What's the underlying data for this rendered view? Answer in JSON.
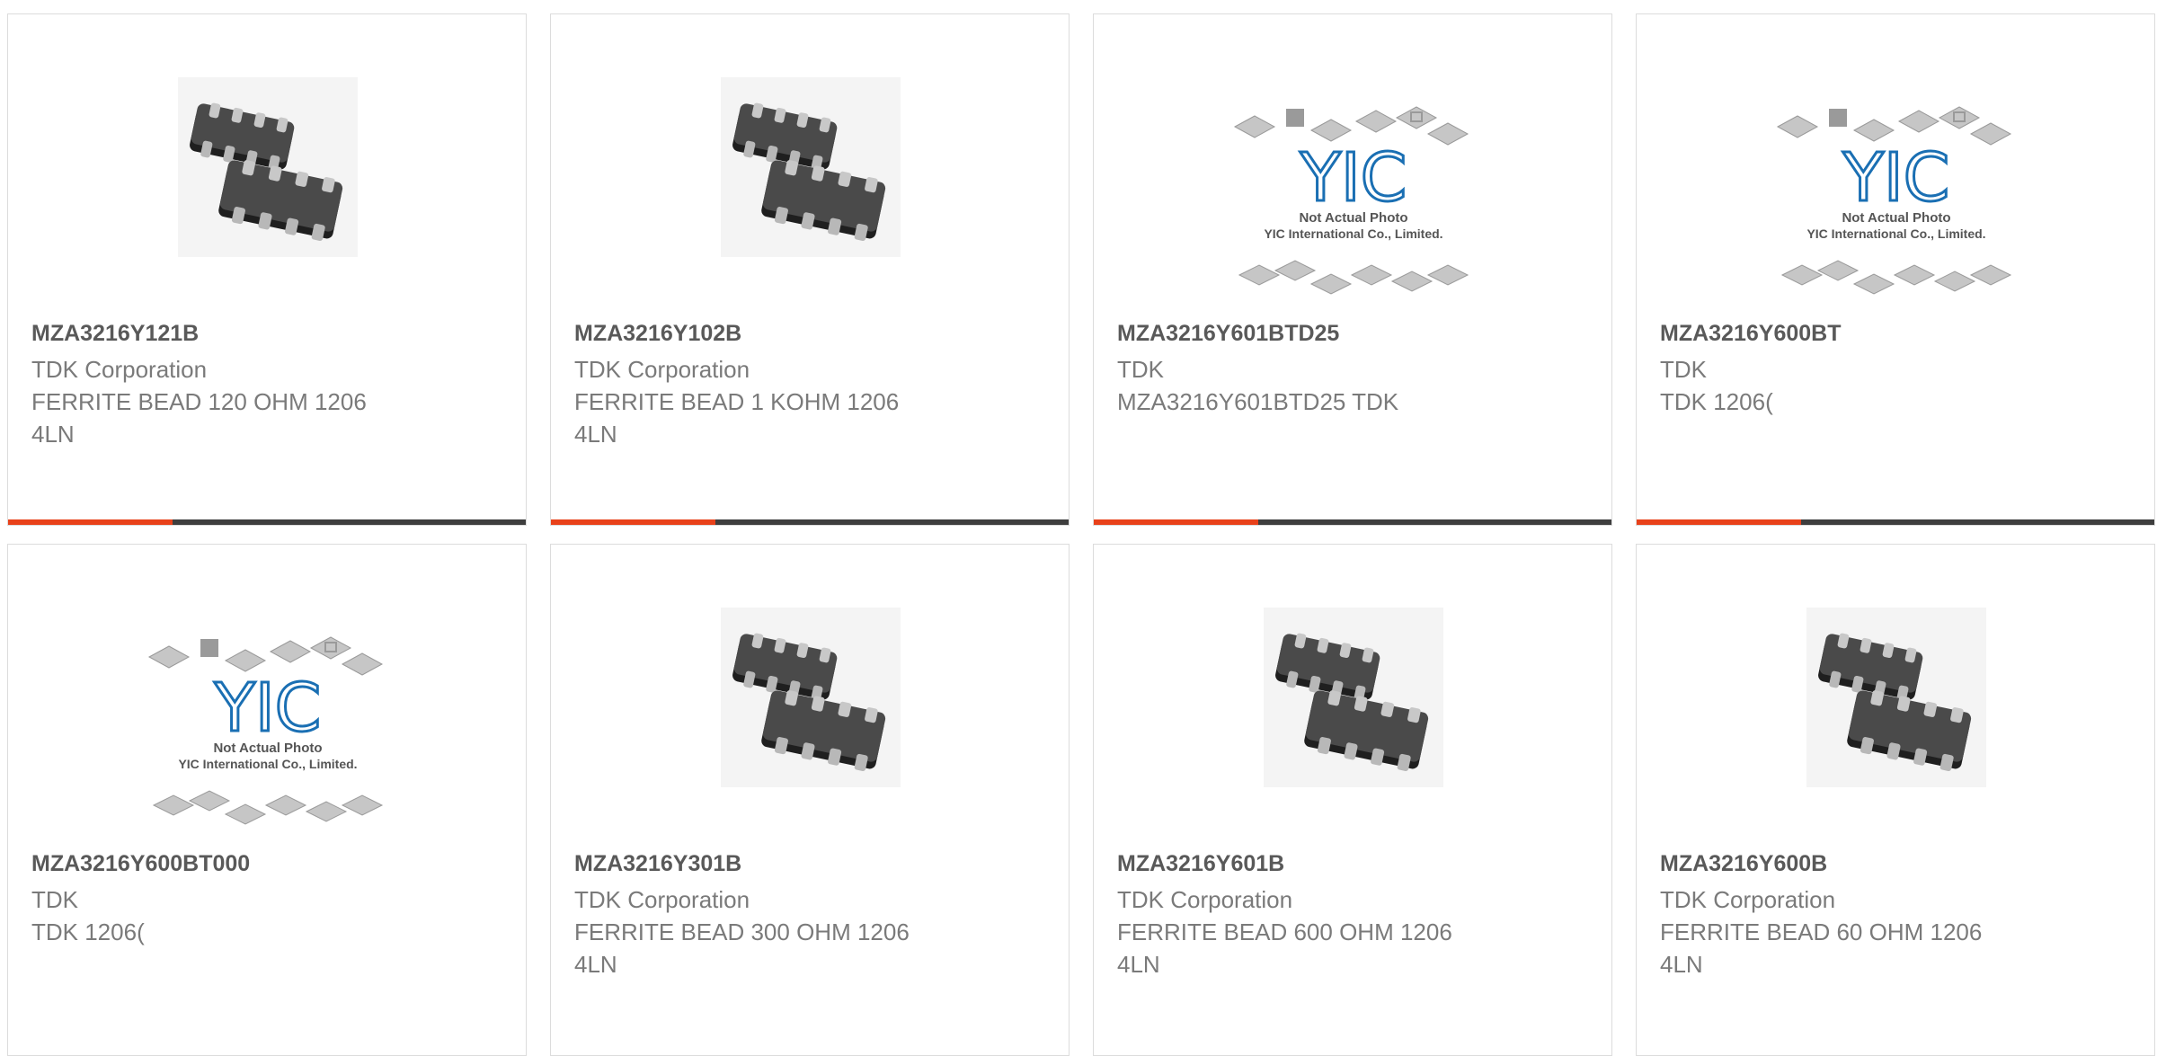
{
  "colors": {
    "accent": "#e8411a",
    "bar": "#3e3e3e",
    "yic_blue": "#1a6fb3"
  },
  "products": [
    {
      "part": "MZA3216Y121B",
      "maker": "TDK Corporation",
      "lines": [
        "FERRITE BEAD 120 OHM 1206",
        "4LN"
      ],
      "image": "chip-photo"
    },
    {
      "part": "MZA3216Y102B",
      "maker": "TDK Corporation",
      "lines": [
        "FERRITE BEAD 1 KOHM 1206",
        "4LN"
      ],
      "image": "chip-photo"
    },
    {
      "part": "MZA3216Y601BTD25",
      "maker": "TDK",
      "lines": [
        "MZA3216Y601BTD25 TDK"
      ],
      "image": "yic-placeholder"
    },
    {
      "part": "MZA3216Y600BT",
      "maker": "TDK",
      "lines": [
        "TDK 1206("
      ],
      "image": "yic-placeholder"
    },
    {
      "part": "MZA3216Y600BT000",
      "maker": "TDK",
      "lines": [
        "TDK 1206("
      ],
      "image": "yic-placeholder"
    },
    {
      "part": "MZA3216Y301B",
      "maker": "TDK Corporation",
      "lines": [
        "FERRITE BEAD 300 OHM 1206",
        "4LN"
      ],
      "image": "chip-photo"
    },
    {
      "part": "MZA3216Y601B",
      "maker": "TDK Corporation",
      "lines": [
        "FERRITE BEAD 600 OHM 1206",
        "4LN"
      ],
      "image": "chip-photo"
    },
    {
      "part": "MZA3216Y600B",
      "maker": "TDK Corporation",
      "lines": [
        "FERRITE BEAD 60 OHM 1206",
        "4LN"
      ],
      "image": "chip-photo"
    }
  ],
  "placeholder": {
    "line1": "Not Actual Photo",
    "line2": "YIC International Co., Limited.",
    "logo": "YIC"
  }
}
